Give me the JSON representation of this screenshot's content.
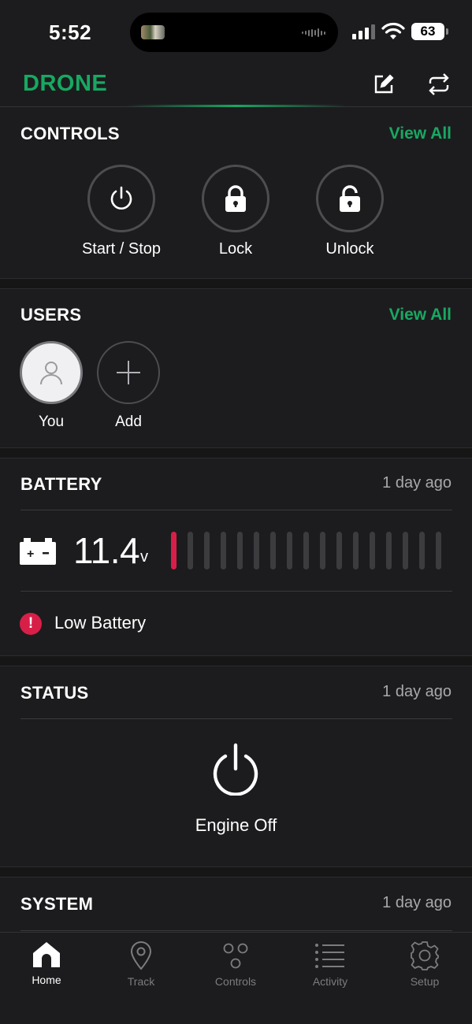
{
  "status_bar": {
    "time": "5:52",
    "battery_level": "63"
  },
  "header": {
    "logo": "DRONE",
    "icons": [
      "edit-icon",
      "sync-icon"
    ],
    "accent_color": "#18a862"
  },
  "controls": {
    "title": "CONTROLS",
    "view_all": "View All",
    "items": [
      {
        "label": "Start / Stop",
        "icon": "power-icon"
      },
      {
        "label": "Lock",
        "icon": "lock-icon"
      },
      {
        "label": "Unlock",
        "icon": "unlock-icon"
      }
    ]
  },
  "users": {
    "title": "USERS",
    "view_all": "View All",
    "items": [
      {
        "label": "You",
        "icon": "user-icon"
      },
      {
        "label": "Add",
        "icon": "plus-icon"
      }
    ]
  },
  "battery": {
    "title": "BATTERY",
    "updated": "1 day ago",
    "voltage": "11.4",
    "unit": "v",
    "level_segments_total": 17,
    "level_segments_on": 1,
    "alert_color": "#d81f48",
    "alert": "Low Battery"
  },
  "status": {
    "title": "STATUS",
    "updated": "1 day ago",
    "engine": "Engine Off"
  },
  "system": {
    "title": "SYSTEM",
    "updated": "1 day ago"
  },
  "tabs": [
    {
      "label": "Home",
      "icon": "home-icon",
      "active": true
    },
    {
      "label": "Track",
      "icon": "location-pin-icon",
      "active": false
    },
    {
      "label": "Controls",
      "icon": "controls-icon",
      "active": false
    },
    {
      "label": "Activity",
      "icon": "list-icon",
      "active": false
    },
    {
      "label": "Setup",
      "icon": "gear-icon",
      "active": false
    }
  ]
}
